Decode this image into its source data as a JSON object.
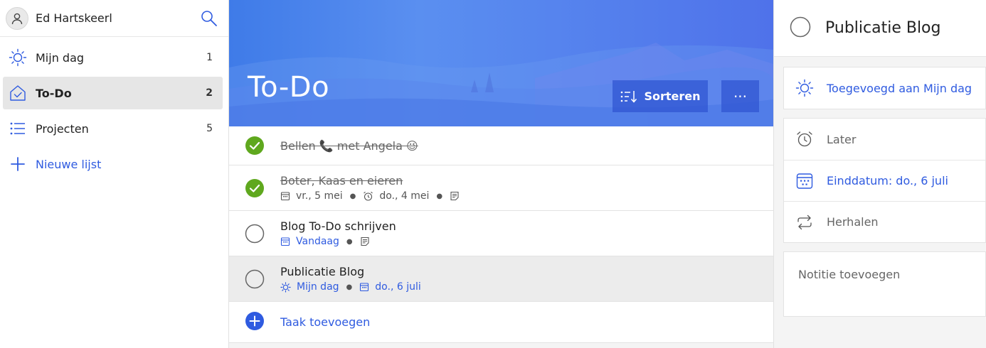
{
  "user": {
    "name": "Ed Hartskeerl"
  },
  "sidebar": {
    "items": [
      {
        "label": "Mijn dag",
        "count": "1"
      },
      {
        "label": "To-Do",
        "count": "2"
      },
      {
        "label": "Projecten",
        "count": "5"
      }
    ],
    "new_list_label": "Nieuwe lijst"
  },
  "main": {
    "title": "To-Do",
    "sort_label": "Sorteren",
    "more_label": "···",
    "tasks": [
      {
        "title": "Bellen 📞 met Angela 😉",
        "done": true
      },
      {
        "title": "Boter, Kaas en eieren",
        "done": true,
        "meta": [
          "vr., 5 mei",
          "do., 4 mei"
        ]
      },
      {
        "title": "Blog To-Do schrijven",
        "done": false,
        "meta": [
          "Vandaag"
        ]
      },
      {
        "title": "Publicatie Blog",
        "done": false,
        "meta": [
          "Mijn dag",
          "do., 6 juli"
        ]
      }
    ],
    "add_task_label": "Taak toevoegen"
  },
  "detail": {
    "title": "Publicatie Blog",
    "my_day_label": "Toegevoegd aan Mijn dag",
    "reminder_label": "Later",
    "due_label": "Einddatum: do., 6 juli",
    "repeat_label": "Herhalen",
    "note_placeholder": "Notitie toevoegen"
  },
  "colors": {
    "accent": "#2f5be0",
    "done_green": "#5fa81e",
    "banner_start": "#3f7be8",
    "banner_end": "#4f72ea"
  }
}
